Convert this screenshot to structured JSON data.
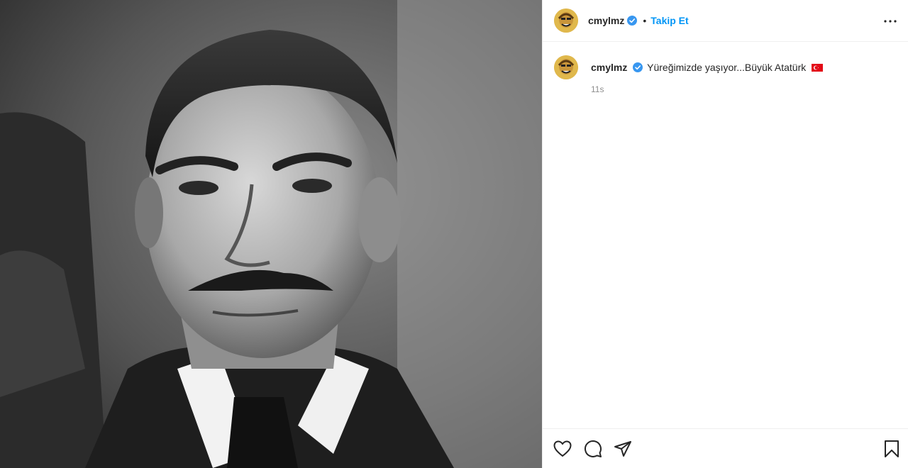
{
  "post": {
    "username": "cmylmz",
    "verified": true,
    "follow_label": "Takip Et",
    "separator": "•",
    "caption": "Yüreğimizde yaşıyor...Büyük Atatürk",
    "time": "11s"
  },
  "icons": {
    "more": "more-options-icon",
    "like": "heart-icon",
    "comment": "comment-bubble-icon",
    "share": "paper-plane-icon",
    "save": "bookmark-icon",
    "flag": "turkey-flag-emoji"
  },
  "colors": {
    "link_blue": "#0095f6",
    "verified_blue": "#3897f0",
    "muted_gray": "#8e8e8e",
    "flag_red": "#e30a17"
  }
}
